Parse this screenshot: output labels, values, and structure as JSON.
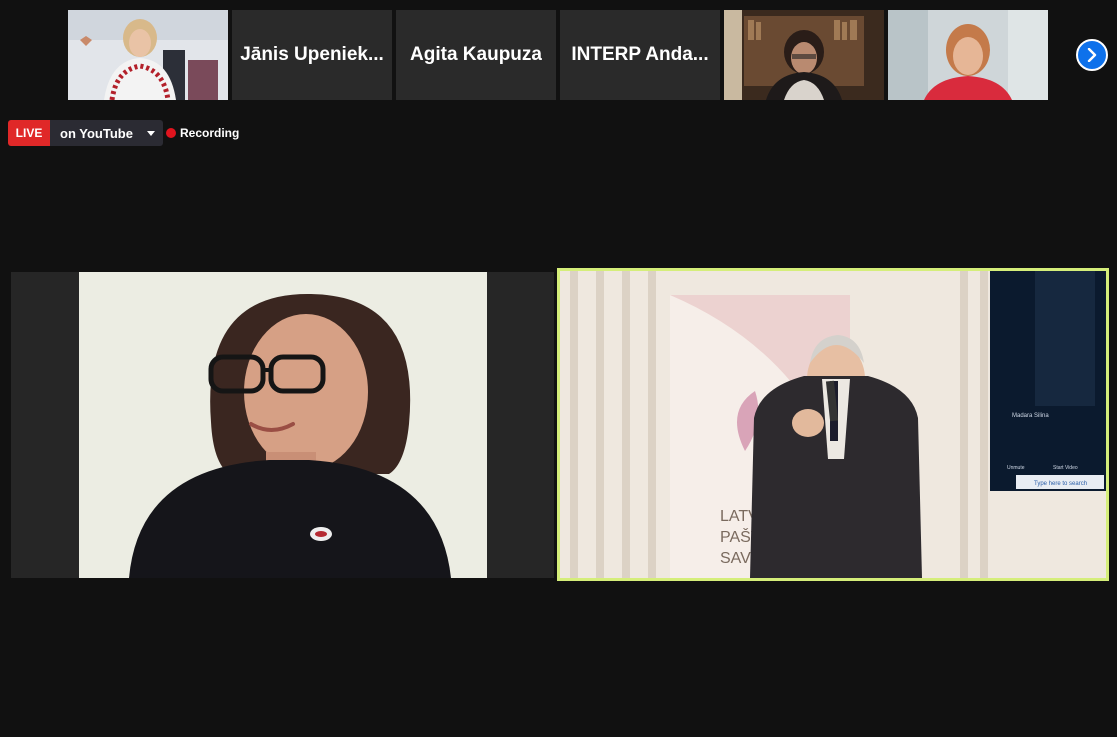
{
  "participants_strip": {
    "thumbnails": [
      {
        "type": "video",
        "icon": "participant-video-woman-office"
      },
      {
        "type": "name",
        "name": "Jānis Upeniek..."
      },
      {
        "type": "name",
        "name": "Agita Kaupuza"
      },
      {
        "type": "name",
        "name": "INTERP Anda..."
      },
      {
        "type": "video",
        "icon": "participant-video-woman-bookshelf"
      },
      {
        "type": "video",
        "icon": "participant-video-woman-red-top"
      }
    ],
    "next_icon": "chevron-right-icon"
  },
  "livestream": {
    "badge": "LIVE",
    "platform": "on YouTube"
  },
  "recording": {
    "label": "Recording",
    "color": "#e0141e"
  },
  "main_view": {
    "left_tile_icon": "participant-video-woman-glasses",
    "right_tile_icon": "participant-video-speaker-podium",
    "banner_lines": [
      "LATVIJAS",
      "PAŠVAL",
      "SAVIEN"
    ],
    "screen_text": {
      "name": "Madara Silina",
      "unmute": "Unmute",
      "start_video": "Start Video",
      "search": "Type here to search"
    },
    "active_speaker_border": "#d5ee7a"
  }
}
